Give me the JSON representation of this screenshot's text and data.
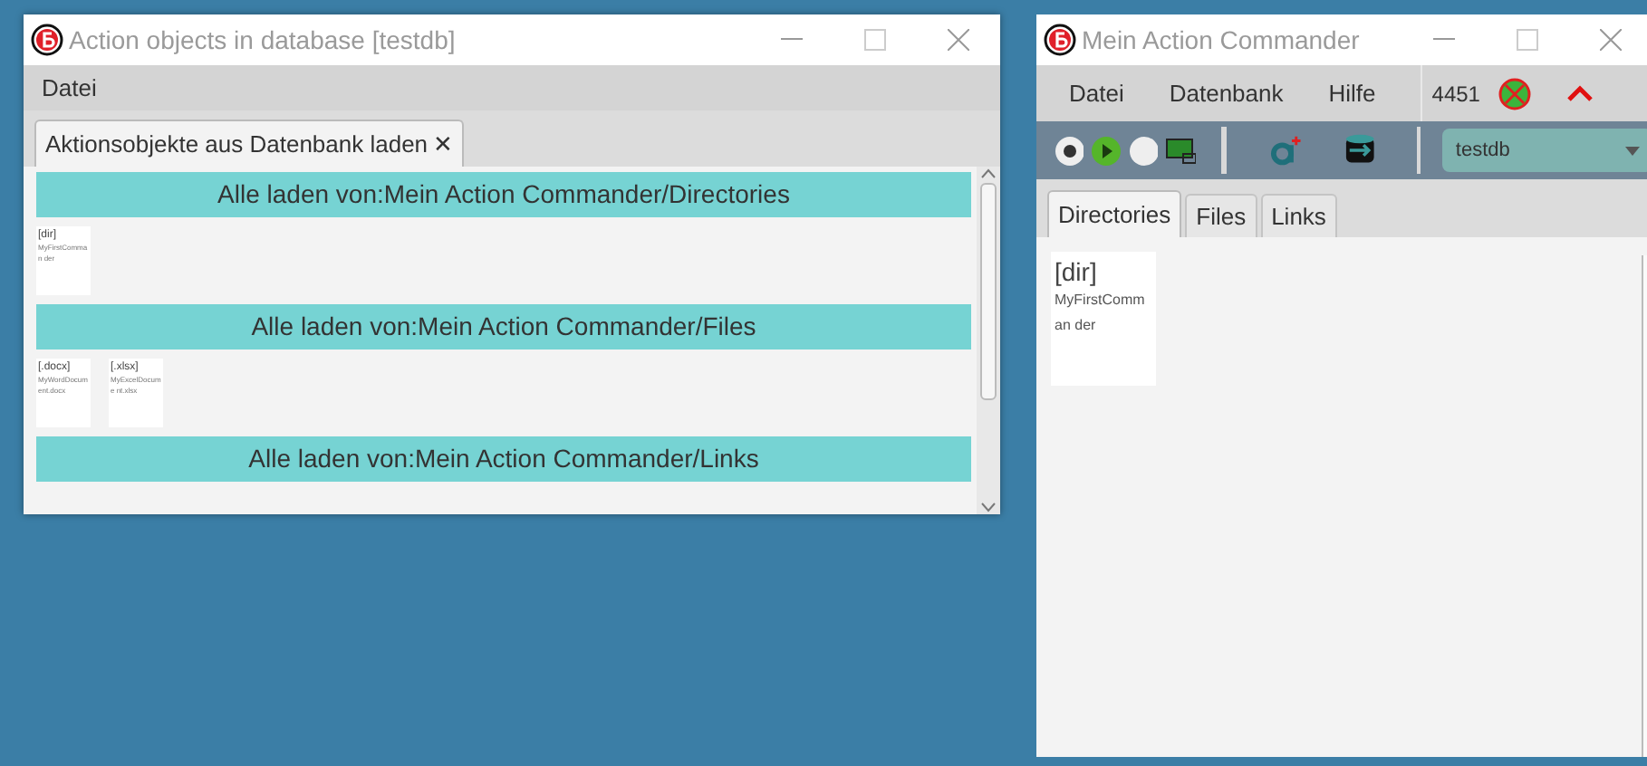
{
  "left_window": {
    "title": "Action objects in database [testdb]",
    "menu": [
      "Datei"
    ],
    "tabs": [
      {
        "label": "Aktionsobjekte aus Datenbank laden",
        "close": "✕",
        "selected": true
      }
    ],
    "sections": [
      {
        "header": "Alle laden von:Mein Action Commander/Directories",
        "items": [
          {
            "type": "[dir]",
            "name": "MyFirstComman der"
          }
        ]
      },
      {
        "header": "Alle laden von:Mein Action Commander/Files",
        "items": [
          {
            "type": "[.docx]",
            "name": "MyWordDocum ent.docx"
          },
          {
            "type": "[.xlsx]",
            "name": "MyExcelDocume nt.xlsx"
          }
        ]
      },
      {
        "header": "Alle laden von:Mein Action Commander/Links"
      }
    ]
  },
  "right_window": {
    "title": "Mein Action Commander",
    "menu": [
      "Datei",
      "Datenbank",
      "Hilfe"
    ],
    "port": "4451",
    "database": "testdb",
    "tabs": [
      {
        "label": "Directories",
        "selected": true
      },
      {
        "label": "Files",
        "selected": false
      },
      {
        "label": "Links",
        "selected": false
      }
    ],
    "items": [
      {
        "type": "[dir]",
        "name": "MyFirstComman der"
      }
    ]
  }
}
